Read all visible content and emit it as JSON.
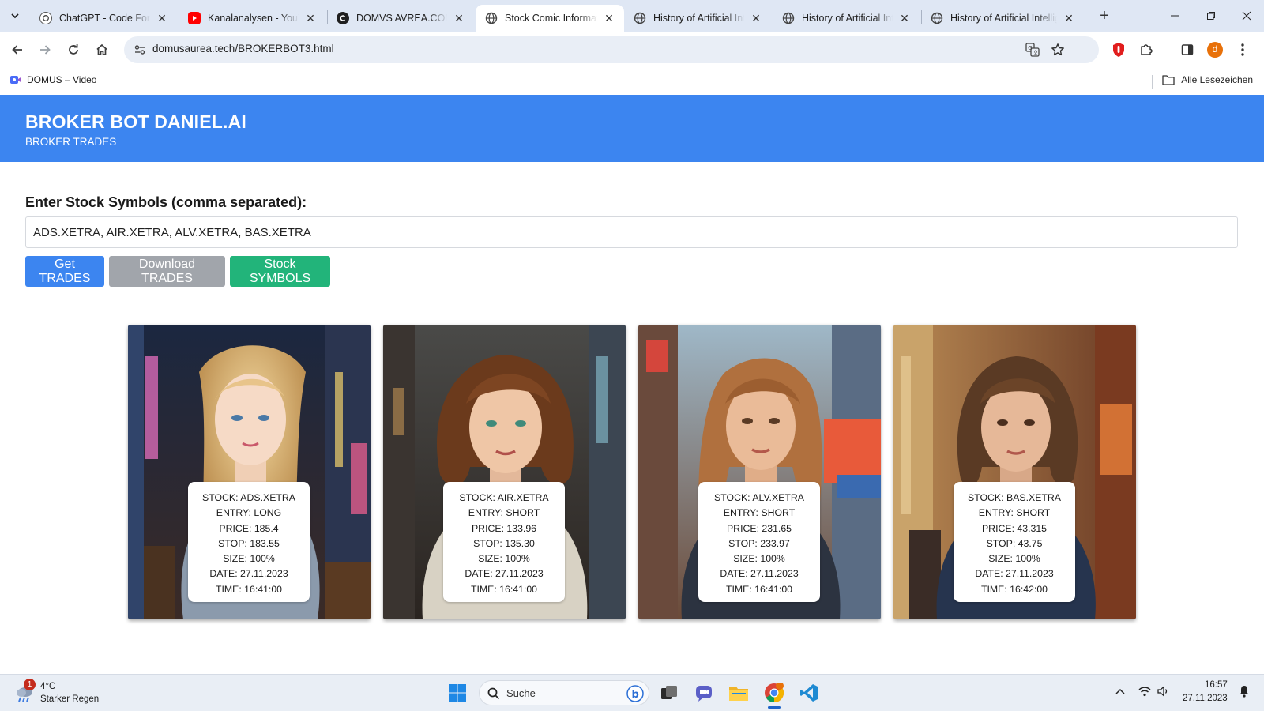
{
  "browser": {
    "tabs": [
      {
        "title": "ChatGPT - Code Formatierung",
        "favicon": "chatgpt-icon",
        "active": false
      },
      {
        "title": "Kanalanalysen - YouTube Studio",
        "favicon": "youtube-icon",
        "active": false
      },
      {
        "title": "DOMVS AVREA.COM",
        "favicon": "domus-icon",
        "active": false
      },
      {
        "title": "Stock Comic Information",
        "favicon": "globe-icon",
        "active": true
      },
      {
        "title": "History of Artificial Intelligence",
        "favicon": "globe-icon",
        "active": false
      },
      {
        "title": "History of Artificial Intelligence",
        "favicon": "globe-icon",
        "active": false
      },
      {
        "title": "History of Artificial Intelligence",
        "favicon": "globe-icon",
        "active": false
      }
    ],
    "url": "domusaurea.tech/BROKERBOT3.html",
    "bookmark": "DOMUS – Video",
    "all_bookmarks": "Alle Lesezeichen",
    "profile_initial": "d"
  },
  "page": {
    "title": "BROKER BOT DANIEL.AI",
    "subtitle": "BROKER TRADES",
    "symbols_label": "Enter Stock Symbols (comma separated):",
    "symbols_value": "ADS.XETRA, AIR.XETRA, ALV.XETRA, BAS.XETRA",
    "buttons": {
      "get": "Get TRADES",
      "download": "Download TRADES",
      "symbols": "Stock SYMBOLS"
    },
    "colors": {
      "header": "#3c85f0",
      "get_button": "#3c85f0",
      "download_button": "#a1a5ab",
      "symbols_button": "#22b47a"
    },
    "trades": [
      {
        "stock": "STOCK: ADS.XETRA",
        "entry": "ENTRY: LONG",
        "price": "PRICE: 185.4",
        "stop": "STOP: 183.55",
        "size": "SIZE: 100%",
        "date": "DATE: 27.11.2023",
        "time": "TIME: 16:41:00"
      },
      {
        "stock": "STOCK: AIR.XETRA",
        "entry": "ENTRY: SHORT",
        "price": "PRICE: 133.96",
        "stop": "STOP: 135.30",
        "size": "SIZE: 100%",
        "date": "DATE: 27.11.2023",
        "time": "TIME: 16:41:00"
      },
      {
        "stock": "STOCK: ALV.XETRA",
        "entry": "ENTRY: SHORT",
        "price": "PRICE: 231.65",
        "stop": "STOP: 233.97",
        "size": "SIZE: 100%",
        "date": "DATE: 27.11.2023",
        "time": "TIME: 16:41:00"
      },
      {
        "stock": "STOCK: BAS.XETRA",
        "entry": "ENTRY: SHORT",
        "price": "PRICE: 43.315",
        "stop": "STOP: 43.75",
        "size": "SIZE: 100%",
        "date": "DATE: 27.11.2023",
        "time": "TIME: 16:42:00"
      }
    ]
  },
  "taskbar": {
    "weather_badge": "1",
    "temperature": "4°C",
    "weather": "Starker Regen",
    "search_placeholder": "Suche",
    "time": "16:57",
    "date": "27.11.2023"
  }
}
